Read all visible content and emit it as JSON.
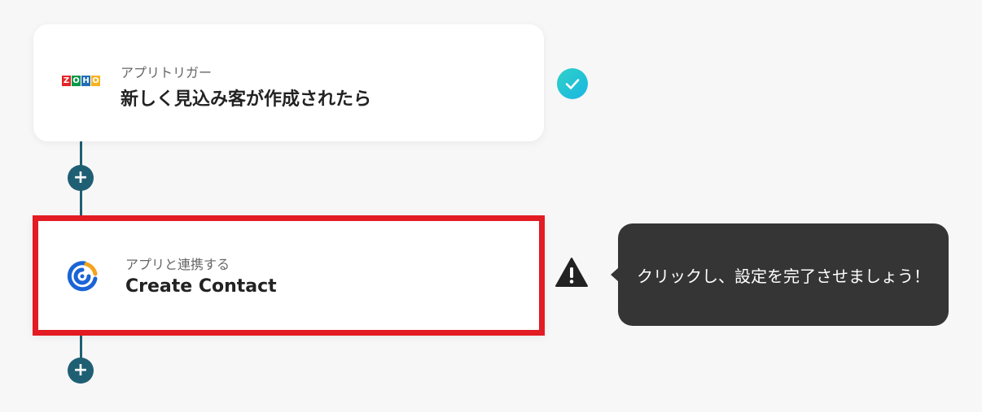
{
  "trigger": {
    "app_name": "ZOHO",
    "subtitle": "アプリトリガー",
    "title": "新しく見込み客が作成されたら",
    "logo_colors": [
      "#e42527",
      "#089949",
      "#226db4",
      "#f9b21d"
    ]
  },
  "action": {
    "subtitle": "アプリと連携する",
    "title": "Create Contact",
    "logo_colors": [
      "#1b64d6",
      "#f4a31a"
    ]
  },
  "tooltip": {
    "text": "クリックし、設定を完了させましょう！"
  },
  "add_step_symbol": "+",
  "status": {
    "trigger": "check-icon",
    "action": "warning-icon"
  }
}
